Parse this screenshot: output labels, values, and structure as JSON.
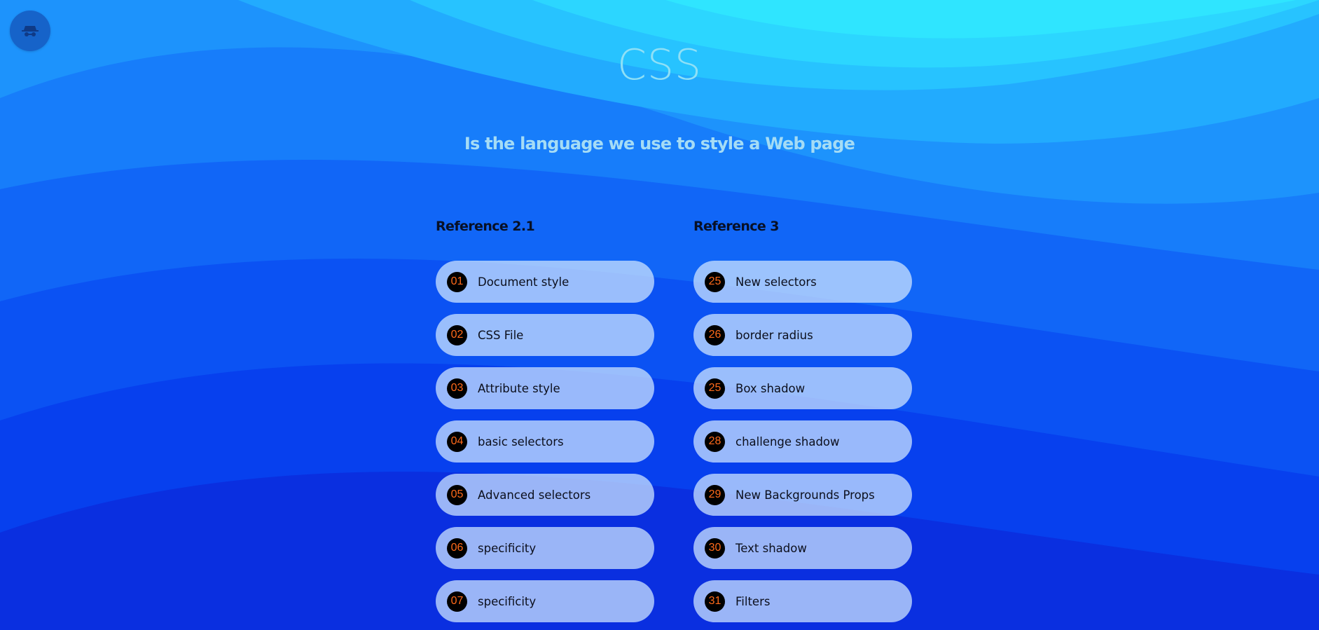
{
  "header": {
    "title": "CSS",
    "subtitle": "Is the language we use to style a Web page"
  },
  "avatar": {
    "icon": "incognito-icon"
  },
  "colors": {
    "title": "#8fe0f6",
    "subtitle": "#a5dcf5",
    "number_text": "#ff6a1a",
    "number_bg": "#000000",
    "item_bg": "#cde4ff"
  },
  "reference_21": {
    "heading": "Reference 2.1",
    "items": [
      {
        "num": "01",
        "label": "Document style"
      },
      {
        "num": "02",
        "label": "CSS File"
      },
      {
        "num": "03",
        "label": "Attribute style"
      },
      {
        "num": "04",
        "label": "basic selectors"
      },
      {
        "num": "05",
        "label": "Advanced selectors"
      },
      {
        "num": "06",
        "label": "specificity"
      },
      {
        "num": "07",
        "label": "specificity"
      }
    ]
  },
  "reference_3": {
    "heading": "Reference 3",
    "items": [
      {
        "num": "25",
        "label": "New selectors"
      },
      {
        "num": "26",
        "label": "border radius"
      },
      {
        "num": "25",
        "label": "Box shadow"
      },
      {
        "num": "28",
        "label": "challenge shadow"
      },
      {
        "num": "29",
        "label": "New Backgrounds Props"
      },
      {
        "num": "30",
        "label": "Text shadow"
      },
      {
        "num": "31",
        "label": "Filters"
      }
    ]
  }
}
